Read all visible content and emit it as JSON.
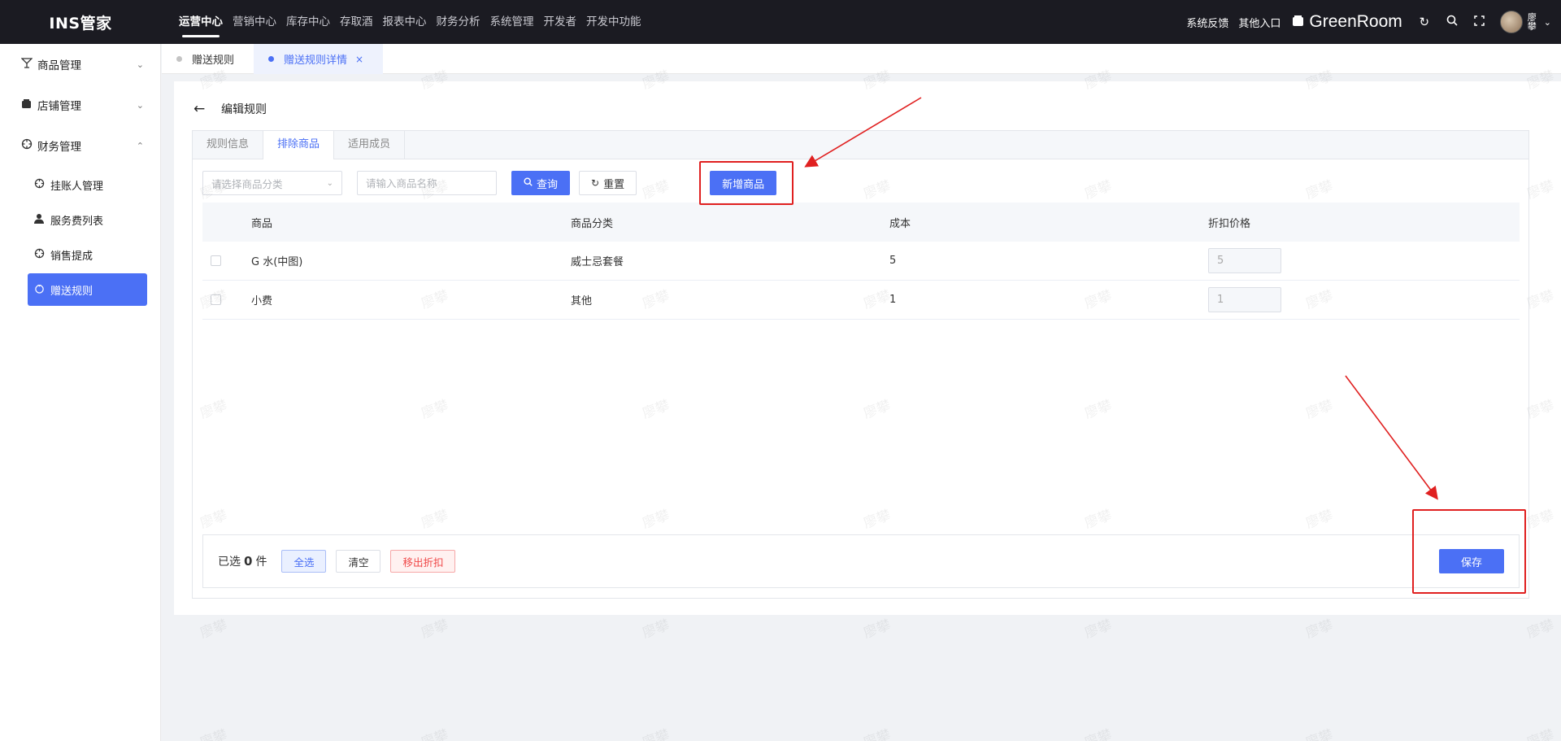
{
  "app": {
    "logo": "INS管家"
  },
  "nav": [
    {
      "label": "运营中心",
      "active": true
    },
    {
      "label": "营销中心"
    },
    {
      "label": "库存中心"
    },
    {
      "label": "存取酒"
    },
    {
      "label": "报表中心"
    },
    {
      "label": "财务分析"
    },
    {
      "label": "系统管理"
    },
    {
      "label": "开发者"
    },
    {
      "label": "开发中功能"
    }
  ],
  "topright": {
    "feedback": "系统反馈",
    "other_entry": "其他入口",
    "store_name": "GreenRoom",
    "user_name": "廖攀"
  },
  "sidebar": {
    "groups": [
      {
        "label": "商品管理",
        "icon": "cocktail-icon",
        "expanded": false
      },
      {
        "label": "店铺管理",
        "icon": "store-icon",
        "expanded": false
      },
      {
        "label": "财务管理",
        "icon": "finance-icon",
        "expanded": true
      }
    ],
    "sub_items": [
      {
        "label": "挂账人管理",
        "icon": "target-icon"
      },
      {
        "label": "服务费列表",
        "icon": "user-icon"
      },
      {
        "label": "销售提成",
        "icon": "target-icon"
      },
      {
        "label": "赠送规则",
        "icon": "gift-icon",
        "active": true
      }
    ]
  },
  "page_tabs": [
    {
      "label": "赠送规则",
      "active": false
    },
    {
      "label": "赠送规则详情",
      "active": true,
      "close": "×"
    }
  ],
  "page": {
    "title": "编辑规则"
  },
  "inner_tabs": [
    {
      "label": "规则信息",
      "active": false
    },
    {
      "label": "排除商品",
      "active": true
    },
    {
      "label": "适用成员",
      "active": false
    }
  ],
  "filters": {
    "category_placeholder": "请选择商品分类",
    "name_placeholder": "请输入商品名称",
    "query_label": "查询",
    "reset_label": "重置",
    "add_label": "新增商品"
  },
  "table": {
    "columns": [
      "商品",
      "商品分类",
      "成本",
      "折扣价格"
    ],
    "rows": [
      {
        "name": "G 水(中图)",
        "category": "威士忌套餐",
        "cost": "5",
        "price": "5"
      },
      {
        "name": "小费",
        "category": "其他",
        "cost": "1",
        "price": "1"
      }
    ]
  },
  "footer": {
    "selected_prefix": "已选",
    "selected_count": "0",
    "selected_suffix": "件",
    "select_all": "全选",
    "clear": "清空",
    "remove": "移出折扣",
    "save": "保存"
  },
  "watermark": "廖攀",
  "colors": {
    "accent": "#4b70f5",
    "topbar": "#1b1b22",
    "annotation": "#e02020"
  }
}
